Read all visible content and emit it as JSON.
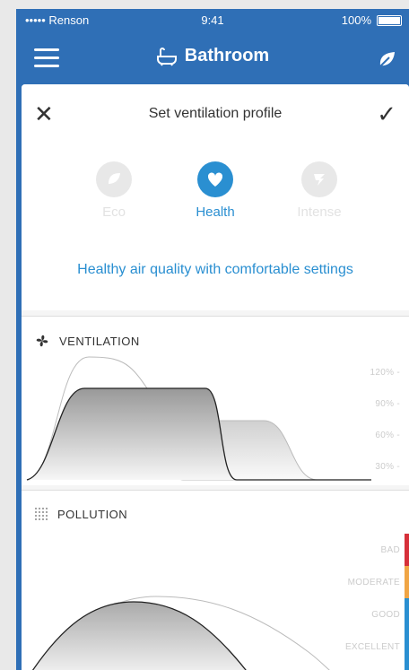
{
  "statusbar": {
    "carrier": "••••• Renson",
    "time": "9:41",
    "battery": "100%"
  },
  "nav": {
    "title": "Bathroom",
    "menu_icon": "hamburger-icon",
    "bath_icon": "bathtub-icon",
    "leaf_icon": "leaf-icon"
  },
  "sheet": {
    "title": "Set ventilation profile",
    "profiles": [
      {
        "label": "Eco",
        "icon": "leaf-icon",
        "selected": false
      },
      {
        "label": "Health",
        "icon": "heart-icon",
        "selected": true
      },
      {
        "label": "Intense",
        "icon": "intense-icon",
        "selected": false
      }
    ],
    "description": "Healthy air quality with comfortable settings"
  },
  "ventilation": {
    "title": "VENTILATION",
    "icon": "fan-icon",
    "scale": [
      "120% -",
      "90% -",
      "60% -",
      "30% -"
    ]
  },
  "pollution": {
    "title": "POLLUTION",
    "icon": "dots-grid-icon",
    "scale": [
      "BAD",
      "MODERATE",
      "GOOD",
      "EXCELLENT"
    ],
    "level_colors": [
      "#d6303a",
      "#f0a545",
      "#2a8fd1"
    ]
  },
  "colors": {
    "primary": "#2f6fb6",
    "accent": "#2a8fd1"
  }
}
